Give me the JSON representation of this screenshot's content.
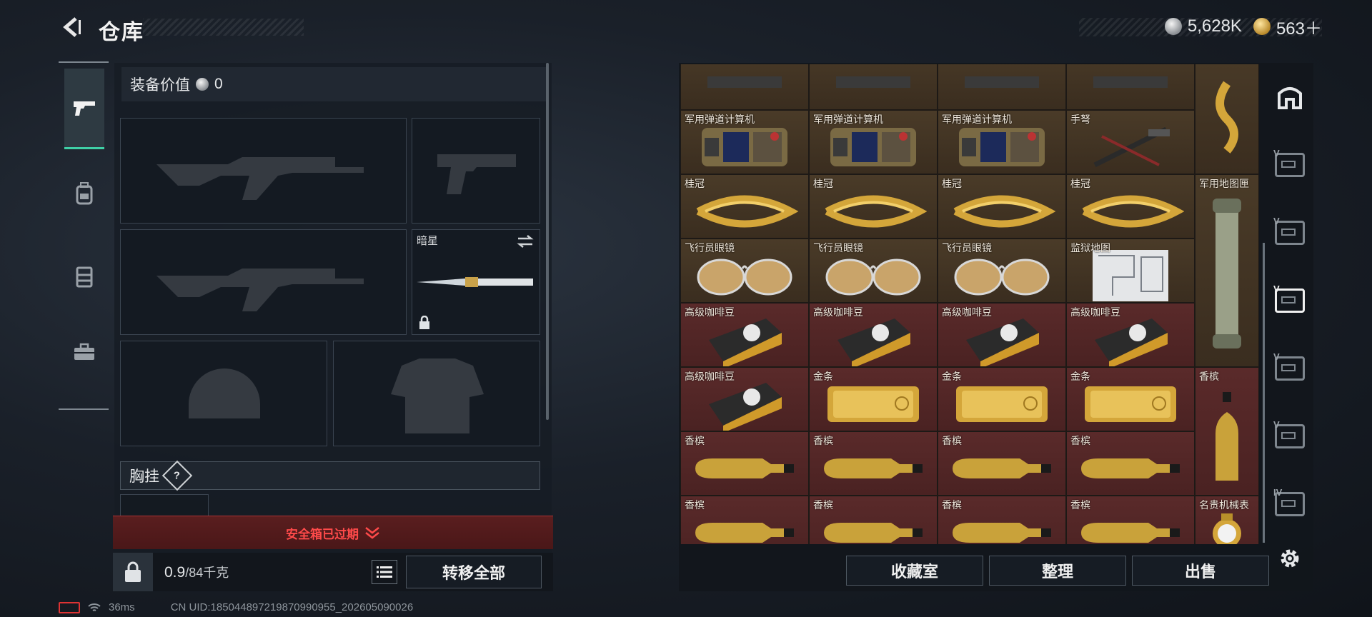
{
  "header": {
    "title": "仓库",
    "currency": [
      {
        "icon": "silver-coin-icon",
        "value": "5,628K"
      },
      {
        "icon": "gold-coin-icon",
        "value": "563＋"
      }
    ]
  },
  "left_tabs": [
    {
      "name": "weapons-tab",
      "icon": "pistol-icon",
      "active": true
    },
    {
      "name": "backpack-tab",
      "icon": "backpack-icon",
      "active": false
    },
    {
      "name": "vest-tab",
      "icon": "vest-icon",
      "active": false
    },
    {
      "name": "case-tab",
      "icon": "briefcase-icon",
      "active": false
    }
  ],
  "equipment": {
    "value_label": "装备价值",
    "value": "0",
    "melee_slot_label": "暗星",
    "chest_rig_label": "胸挂",
    "chest_rig_badge": "?",
    "expired_text": "安全箱已过期",
    "weight_current": "0.9",
    "weight_max": "/84千克",
    "transfer_all": "转移全部"
  },
  "status_bar": {
    "ping": "36ms",
    "uid": "CN UID:185044897219870990955_202605090026"
  },
  "storage": {
    "rows": [
      [
        "",
        "",
        "",
        ""
      ],
      [
        "军用弹道计算机",
        "军用弹道计算机",
        "军用弹道计算机",
        "手弩"
      ],
      [
        "桂冠",
        "桂冠",
        "桂冠",
        "桂冠"
      ],
      [
        "飞行员眼镜",
        "飞行员眼镜",
        "飞行员眼镜",
        "监狱地图"
      ],
      [
        "高级咖啡豆",
        "高级咖啡豆",
        "高级咖啡豆",
        "高级咖啡豆"
      ],
      [
        "高级咖啡豆",
        "金条",
        "金条",
        "金条"
      ],
      [
        "香槟",
        "香槟",
        "香槟",
        "香槟"
      ],
      [
        "香槟",
        "香槟",
        "香槟",
        "香槟"
      ]
    ],
    "side_column": [
      "",
      "军用地图匣",
      "香槟",
      "名贵机械表"
    ],
    "buttons": {
      "collection": "收藏室",
      "organize": "整理",
      "sell": "出售"
    },
    "case_tabs": [
      "",
      "V",
      "V",
      "V",
      "V",
      "V",
      "IV"
    ]
  }
}
